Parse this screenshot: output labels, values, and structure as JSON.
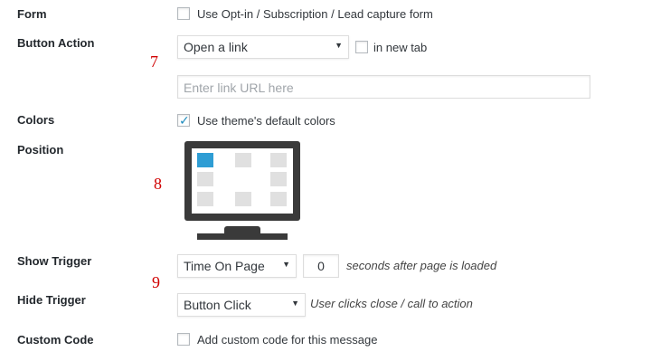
{
  "form": {
    "label": "Form",
    "checkbox_label": "Use Opt-in / Subscription / Lead capture form",
    "checked": false
  },
  "button_action": {
    "label": "Button Action",
    "selected": "Open a link",
    "new_tab_label": "in new tab",
    "new_tab_checked": false,
    "url_placeholder": "Enter link URL here",
    "annotation": "7"
  },
  "colors": {
    "label": "Colors",
    "checkbox_label": "Use theme's default colors",
    "checked": true
  },
  "position": {
    "label": "Position",
    "annotation": "8",
    "selected": "top-left"
  },
  "show_trigger": {
    "label": "Show Trigger",
    "selected": "Time On Page",
    "seconds_value": "0",
    "suffix": "seconds after page is loaded",
    "annotation": "9"
  },
  "hide_trigger": {
    "label": "Hide Trigger",
    "selected": "Button Click",
    "suffix": "User clicks close / call to action"
  },
  "custom_code": {
    "label": "Custom Code",
    "checkbox_label": "Add custom code for this message",
    "checked": false
  },
  "colors_hex": {
    "accent": "#2e9dd4",
    "checkmark": "#1e8cbe",
    "annotation": "#d00000",
    "monitor": "#3a3a3a"
  }
}
